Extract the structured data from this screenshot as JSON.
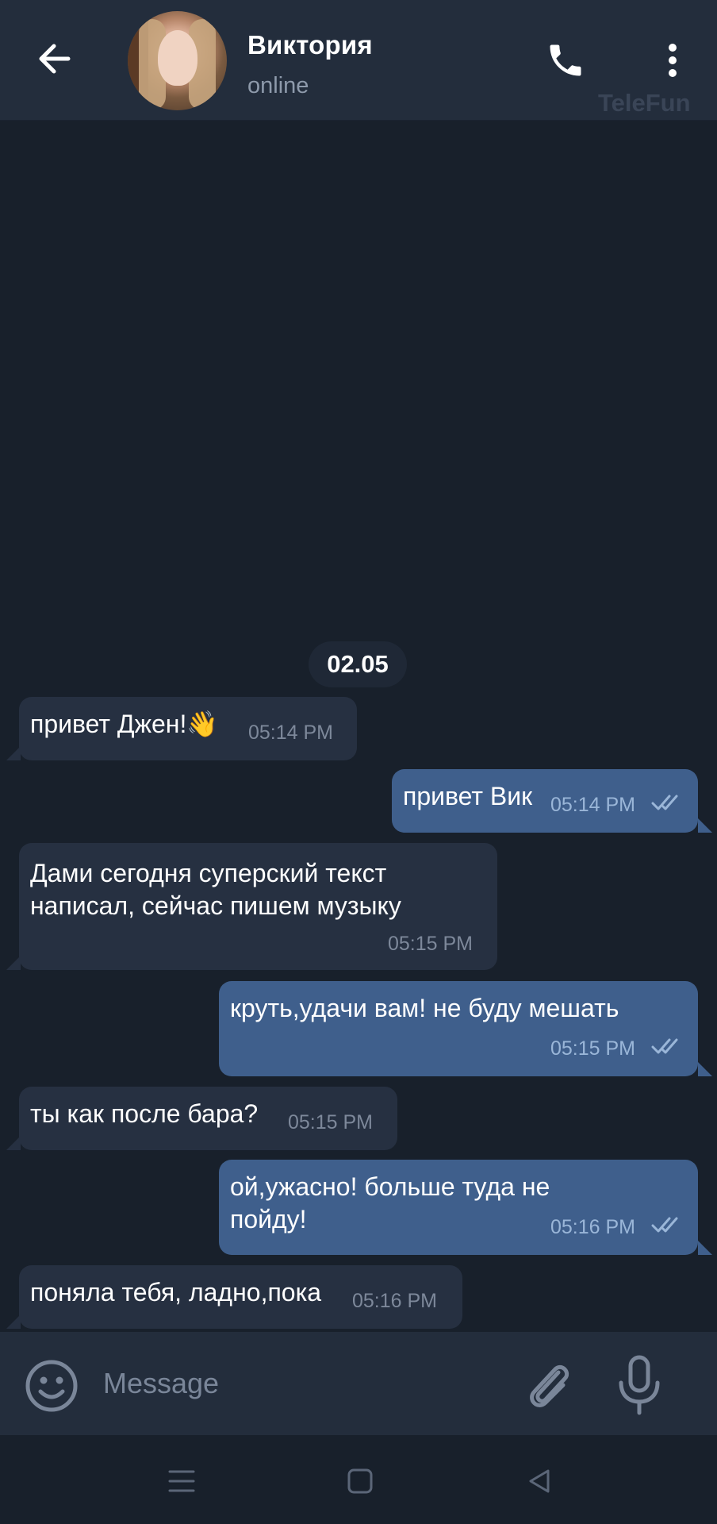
{
  "header": {
    "contact_name": "Виктория",
    "status": "online",
    "watermark": "TeleFun"
  },
  "chat": {
    "date": "02.05",
    "messages": [
      {
        "dir": "in",
        "text": "привет Джен!",
        "time": "05:14 PM"
      },
      {
        "dir": "out",
        "text": "привет Вик",
        "time": "05:14 PM",
        "read": true
      },
      {
        "dir": "in",
        "text": "Дами сегодня суперский текст\nнаписал, сейчас пишем музыку",
        "time": "05:15 PM"
      },
      {
        "dir": "out",
        "text": "круть,удачи вам! не буду мешать",
        "time": "05:15 PM",
        "read": true
      },
      {
        "dir": "in",
        "text": "ты как после бара?",
        "time": "05:15 PM"
      },
      {
        "dir": "out",
        "text": "ой,ужасно! больше туда не\nпойду!",
        "time": "05:16 PM",
        "read": true
      },
      {
        "dir": "in",
        "text": "поняла тебя, ладно,пока",
        "time": "05:16 PM"
      }
    ]
  },
  "composer": {
    "placeholder": "Message"
  },
  "icons": {
    "back": "arrow-left-icon",
    "call": "phone-icon",
    "more": "dots-vertical-icon",
    "emoji": "smiley-icon",
    "attach": "paperclip-icon",
    "mic": "microphone-icon",
    "read": "double-check-icon",
    "wave": "waving-hand-emoji"
  },
  "colors": {
    "background": "#18202b",
    "header": "#232d3c",
    "incoming_bubble": "#263041",
    "outgoing_bubble": "#3f5f8c",
    "read_ticks": "#9ab6d8"
  }
}
